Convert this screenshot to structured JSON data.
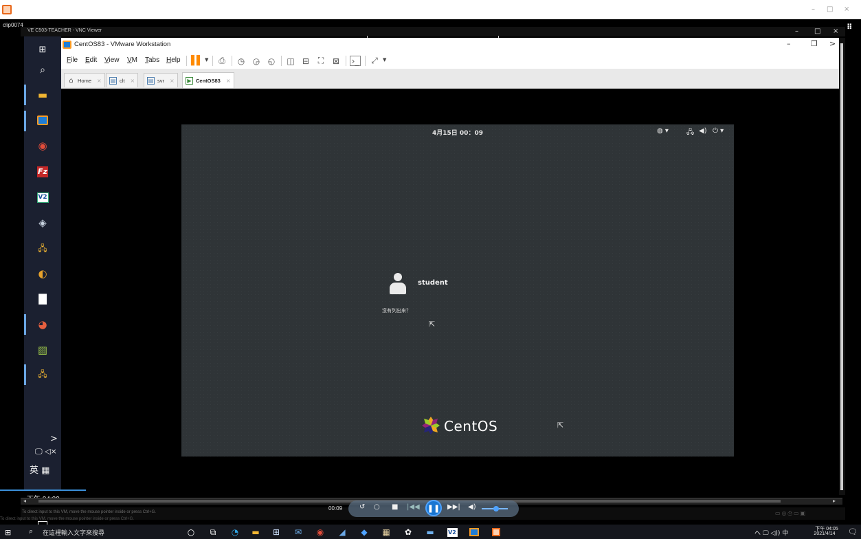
{
  "outer": {
    "min": "–",
    "max": "□",
    "close": "×"
  },
  "recorder": {
    "clip_label": "clip0074"
  },
  "vnc": {
    "title": "VE C503-TEACHER - VNC Viewer",
    "min": "–",
    "max": "□",
    "close": "×",
    "grid_icon": "grid-icon"
  },
  "left_taskbar": {
    "more": ">",
    "net_vol": "🖵 ◁×",
    "ime": "英 ▦",
    "clock": "下午 04:09"
  },
  "vmware": {
    "title": "CentOS83 - VMware Workstation",
    "min": "–",
    "restore": "❐",
    "more": ">",
    "menu": [
      "File",
      "Edit",
      "View",
      "VM",
      "Tabs",
      "Help"
    ],
    "tabs": [
      {
        "label": "Home",
        "icon": "home-icon"
      },
      {
        "label": "clt",
        "icon": "vm-icon"
      },
      {
        "label": "svr",
        "icon": "vm-icon"
      },
      {
        "label": "CentOS83",
        "icon": "vm-running-icon"
      }
    ]
  },
  "guest": {
    "date": "4月15日 00：09",
    "username": "student",
    "not_listed": "沒有列出來？",
    "logo_text": "CentOS",
    "status_icons": [
      "accessibility-icon",
      "network-icon",
      "volume-icon",
      "power-icon"
    ]
  },
  "status": {
    "hint": "To direct input to this VM, move the mouse pointer inside or press Ctrl+G.",
    "hint2": "To direct input to this VM, move the mouse pointer inside or press Ctrl+G."
  },
  "player": {
    "time": "00:09"
  },
  "host_taskbar": {
    "search_placeholder": "在這裡輸入文字來搜尋",
    "tray": "へ 🖵 ◁)) 中",
    "time": "下午 04:05",
    "date": "2021/4/14"
  },
  "colors": {
    "accent": "#1976d2",
    "vmware_orange": "#ff8a00",
    "guest_bg": "#2f3437"
  }
}
